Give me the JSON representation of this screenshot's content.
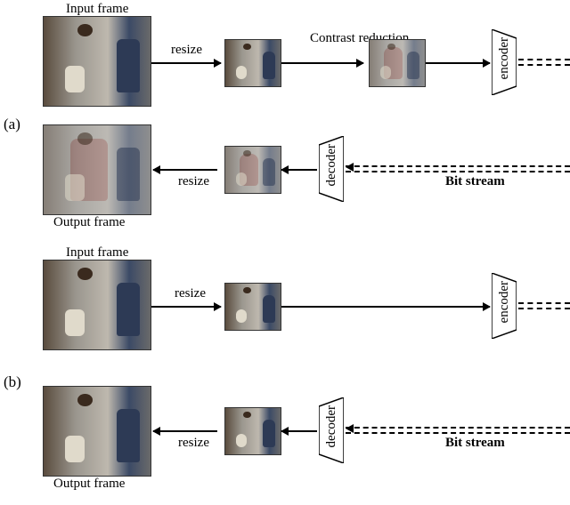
{
  "labels": {
    "input_frame": "Input frame",
    "output_frame": "Output frame",
    "resize": "resize",
    "contrast_reduction": "Contrast reduction",
    "encoder": "encoder",
    "decoder": "decoder",
    "bit_stream": "Bit stream",
    "panel_a": "(a)",
    "panel_b": "(b)"
  }
}
